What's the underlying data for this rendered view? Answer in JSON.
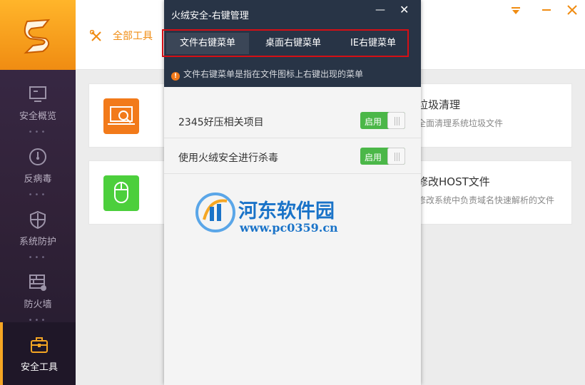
{
  "sidebar": {
    "items": [
      {
        "label": "安全概览",
        "icon": "monitor-icon"
      },
      {
        "label": "反病毒",
        "icon": "gauge-icon"
      },
      {
        "label": "系统防护",
        "icon": "shield-icon"
      },
      {
        "label": "防火墙",
        "icon": "firewall-icon"
      },
      {
        "label": "安全工具",
        "icon": "toolbox-icon",
        "active": true
      }
    ],
    "accent": "#f5a623"
  },
  "topbar": {
    "tools_label": "全部工具"
  },
  "cards": [
    {
      "title": "垃圾清理",
      "desc": "全面清理系统垃圾文件",
      "icon": "laptop-search-icon"
    },
    {
      "title": "修改HOST文件",
      "desc": "修改系统中负责域名快速解析的文件",
      "icon": "mouse-icon"
    }
  ],
  "modal": {
    "title": "火绒安全-右键管理",
    "tabs": [
      {
        "label": "文件右键菜单",
        "active": true
      },
      {
        "label": "桌面右键菜单",
        "active": false
      },
      {
        "label": "IE右键菜单",
        "active": false
      }
    ],
    "notice": "文件右键菜单是指在文件图标上右键出现的菜单",
    "rows": [
      {
        "label": "2345好压相关项目",
        "toggle": "启用"
      },
      {
        "label": "使用火绒安全进行杀毒",
        "toggle": "启用"
      }
    ]
  },
  "watermark": {
    "name": "河东软件园",
    "url": "www.pc0359.cn"
  },
  "colors": {
    "brand_orange": "#f08c12",
    "header_dark": "#283446",
    "toggle_green": "#4bb748",
    "highlight_red": "#d60f15"
  }
}
